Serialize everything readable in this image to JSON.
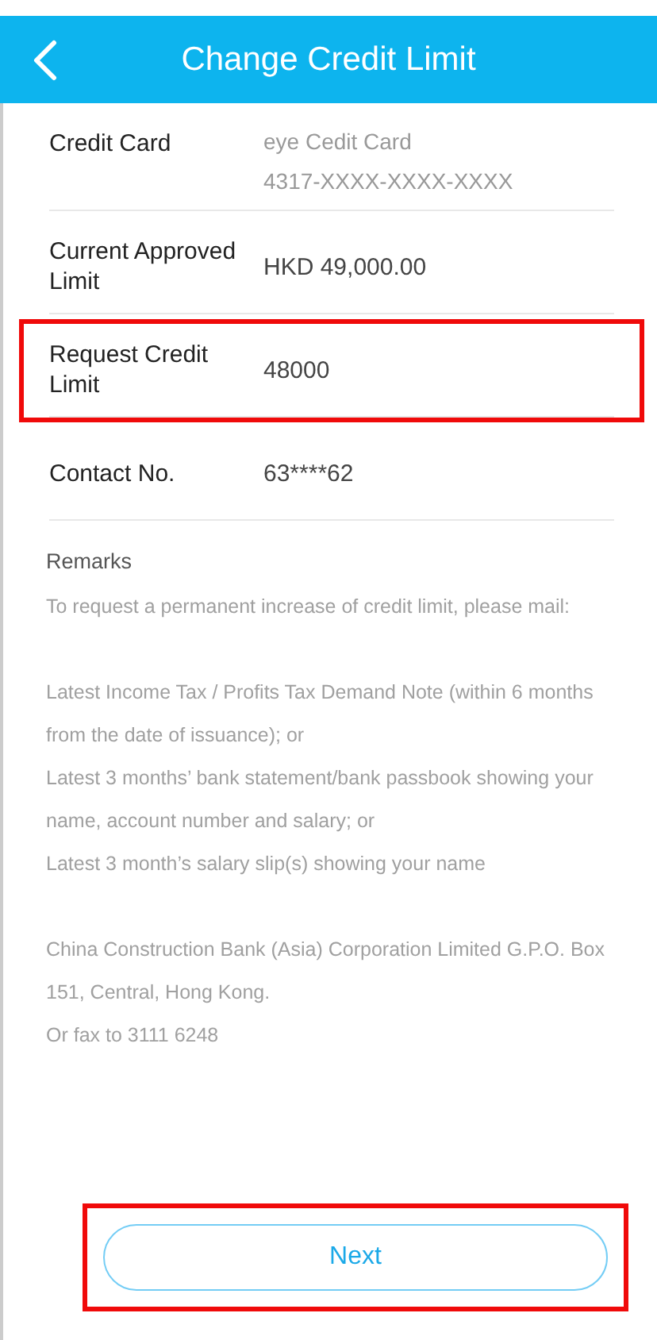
{
  "header": {
    "title": "Change Credit Limit"
  },
  "fields": [
    {
      "label": "Credit Card",
      "values": [
        "eye Cedit Card",
        "4317-XXXX-XXXX-XXXX"
      ],
      "kind": "muted",
      "highlighted": false
    },
    {
      "label": "Current Approved Limit",
      "values": [
        "HKD 49,000.00"
      ],
      "kind": "plain",
      "highlighted": false
    },
    {
      "label": "Request Credit Limit",
      "values": [
        "48000"
      ],
      "kind": "plain",
      "highlighted": true
    },
    {
      "label": "Contact No.",
      "values": [
        "63****62"
      ],
      "kind": "plain",
      "highlighted": false
    }
  ],
  "remarks": {
    "title": "Remarks",
    "paragraphs": [
      [
        "To request a permanent increase of credit limit, please mail:"
      ],
      [
        "Latest Income Tax / Profits Tax Demand Note (within 6 months from the date of issuance); or",
        "Latest 3 months’ bank statement/bank passbook showing your name, account number and salary; or",
        "Latest 3 month’s salary slip(s) showing your name"
      ],
      [
        "China Construction Bank (Asia) Corporation Limited G.P.O. Box 151, Central, Hong Kong.",
        "Or fax to 3111 6248"
      ]
    ]
  },
  "next_button": {
    "label": "Next",
    "highlighted": true
  }
}
